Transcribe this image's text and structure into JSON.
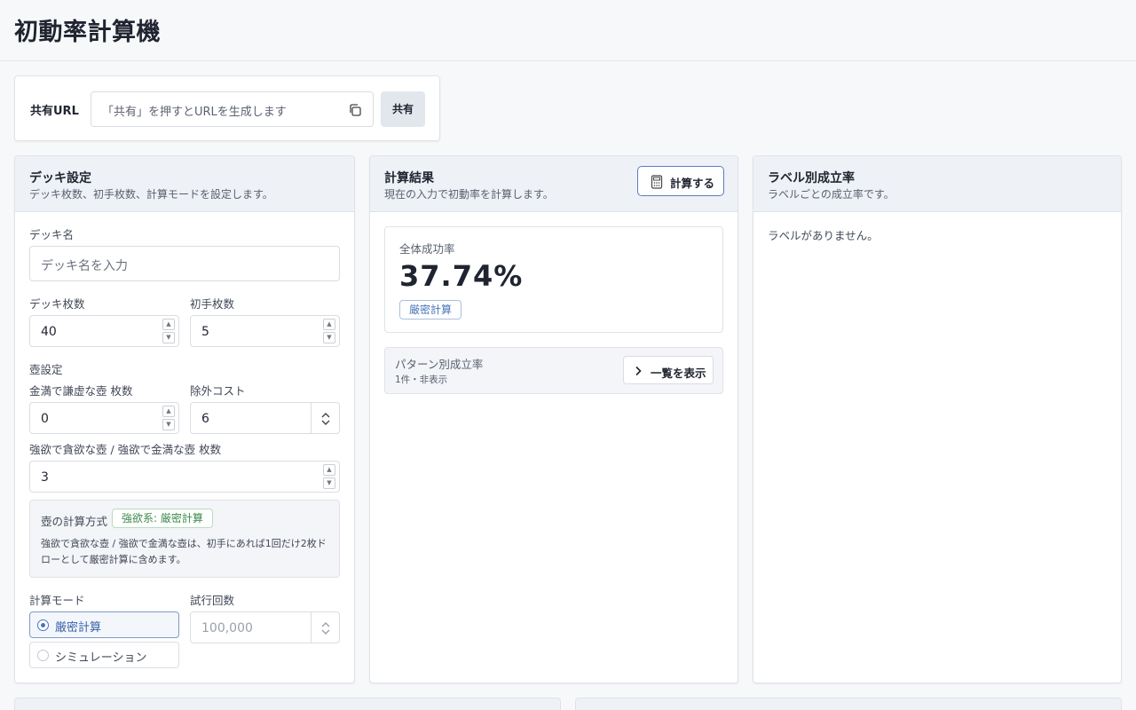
{
  "header": {
    "title": "初動率計算機"
  },
  "share": {
    "label": "共有URL",
    "placeholder": "「共有」を押すとURLを生成します",
    "button": "共有"
  },
  "deck": {
    "title": "デッキ設定",
    "subtitle": "デッキ枚数、初手枚数、計算モードを設定します。",
    "name_label": "デッキ名",
    "name_placeholder": "デッキ名を入力",
    "deck_size_label": "デッキ枚数",
    "deck_size": "40",
    "hand_size_label": "初手枚数",
    "hand_size": "5",
    "pot_section": "壺設定",
    "modest_pot_label": "金満で謙虚な壺 枚数",
    "modest_pot": "0",
    "exclude_cost_label": "除外コスト",
    "exclude_cost": "6",
    "greedy_pot_label": "強欲で貪欲な壺 / 強欲で金満な壺 枚数",
    "greedy_pot": "3",
    "pot_method_label": "壺の計算方式",
    "pot_method_tag": "強欲系: 厳密計算",
    "pot_method_desc": "強欲で貪欲な壺 / 強欲で金満な壺は、初手にあれば1回だけ2枚ドローとして厳密計算に含めます。",
    "mode_label": "計算モード",
    "modes": [
      "厳密計算",
      "シミュレーション"
    ],
    "selected_mode": "厳密計算",
    "trials_label": "試行回数",
    "trials": "100,000"
  },
  "result": {
    "title": "計算結果",
    "subtitle": "現在の入力で初動率を計算します。",
    "calc_button": "計算する",
    "overall_label": "全体成功率",
    "overall_value": "37.74%",
    "mode_tag": "厳密計算",
    "pattern_title": "パターン別成立率",
    "pattern_sub": "1件・非表示",
    "list_button": "一覧を表示"
  },
  "labels": {
    "title": "ラベル別成立率",
    "subtitle": "ラベルごとの成立率です。",
    "empty": "ラベルがありません。"
  },
  "colors": {
    "accent": "#4a74b8",
    "success": "#3b8a4c",
    "panel_header": "#eef1f5"
  }
}
